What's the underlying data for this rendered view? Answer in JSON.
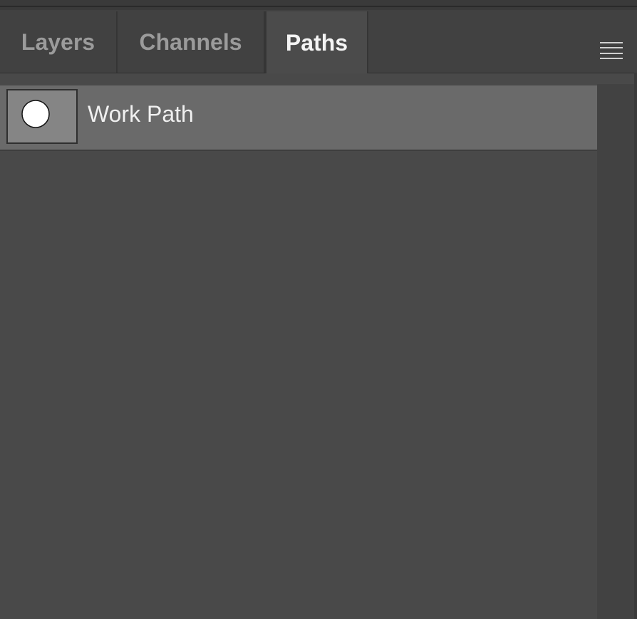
{
  "panel": {
    "tabs": [
      {
        "label": "Layers",
        "active": false
      },
      {
        "label": "Channels",
        "active": false
      },
      {
        "label": "Paths",
        "active": true
      }
    ],
    "menu_icon": "hamburger-menu-icon"
  },
  "paths": [
    {
      "name": "Work Path",
      "thumbnail_icon": "circle-shape-icon",
      "selected": true
    }
  ],
  "colors": {
    "panel_bg": "#494949",
    "tab_bar_bg": "#414141",
    "active_tab_bg": "#4b4b4b",
    "selected_row_bg": "#6a6a6a",
    "active_tab_text": "#f4f4f4",
    "inactive_tab_text": "#9b9b9b"
  }
}
